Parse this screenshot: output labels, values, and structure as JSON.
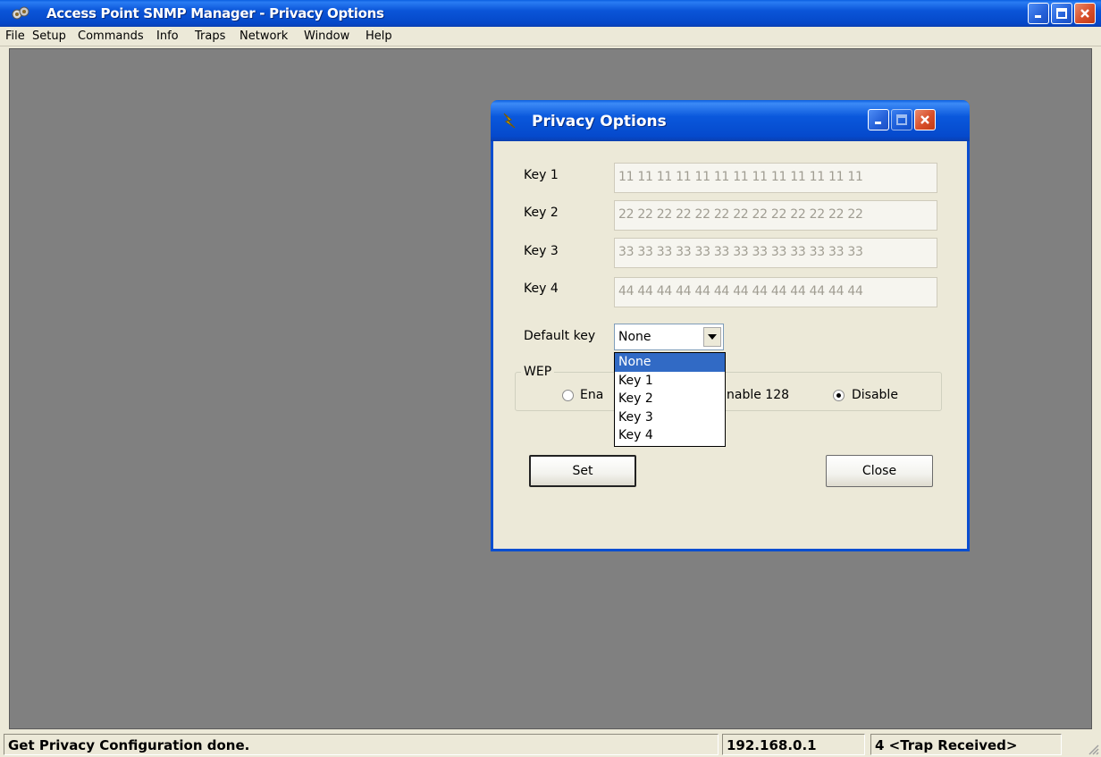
{
  "app": {
    "title": "Access Point SNMP Manager - Privacy Options",
    "menu": {
      "file": "File",
      "setup": "Setup",
      "commands": "Commands",
      "info": "Info",
      "traps": "Traps",
      "network": "Network",
      "window": "Window",
      "help": "Help"
    }
  },
  "dialog": {
    "title": "Privacy Options",
    "keys": [
      {
        "label": "Key 1",
        "value": "11 11 11 11 11 11 11 11 11 11 11 11 11"
      },
      {
        "label": "Key 2",
        "value": "22 22 22 22 22 22 22 22 22 22 22 22 22"
      },
      {
        "label": "Key 3",
        "value": "33 33 33 33 33 33 33 33 33 33 33 33 33"
      },
      {
        "label": "Key 4",
        "value": "44 44 44 44 44 44 44 44 44 44 44 44 44"
      }
    ],
    "default_key": {
      "label": "Default key",
      "selected": "None",
      "options": [
        "None",
        "Key 1",
        "Key 2",
        "Key 3",
        "Key 4"
      ]
    },
    "wep": {
      "legend": "WEP",
      "option_enable64_partial": "Ena",
      "option_enable128_partial": "nable 128",
      "option_disable": "Disable",
      "selected": "Disable"
    },
    "buttons": {
      "set": "Set",
      "close": "Close"
    }
  },
  "statusbar": {
    "message": "Get Privacy Configuration done.",
    "ip": "192.168.0.1",
    "traps": "4 <Trap Received>"
  },
  "colors": {
    "titlebar": "#0a55d8",
    "close_button": "#d84f2a",
    "selection": "#316ac5",
    "workspace": "#808080"
  }
}
